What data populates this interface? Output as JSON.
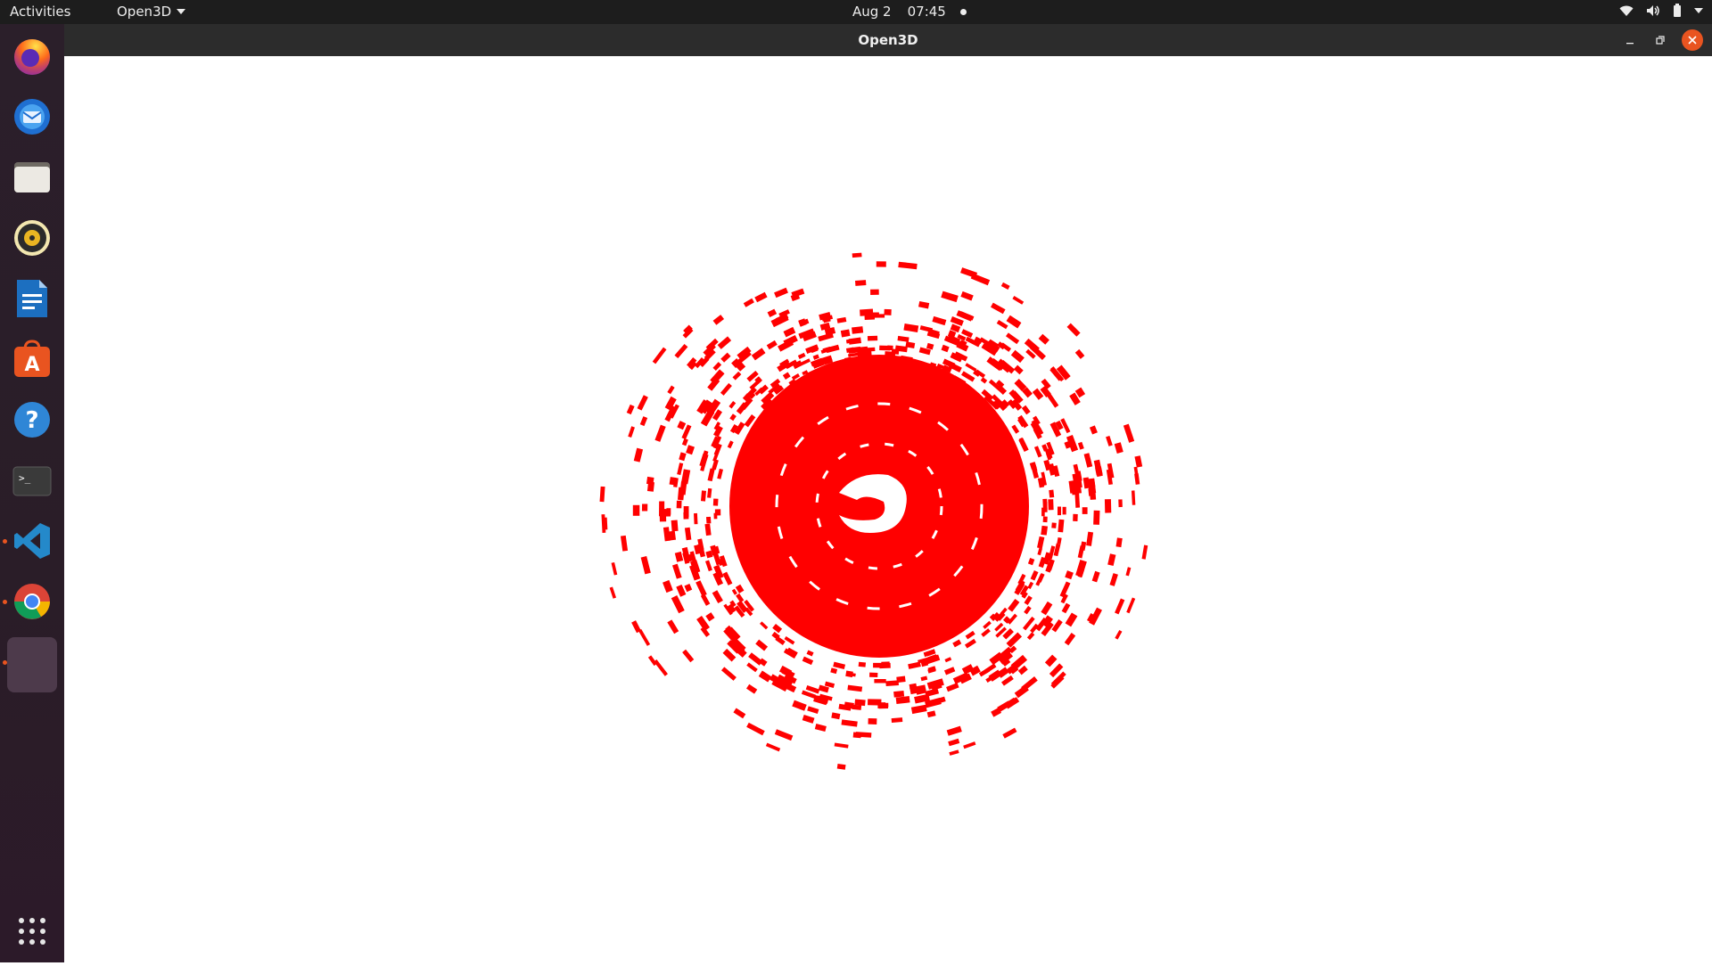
{
  "topbar": {
    "activities_label": "Activities",
    "app_menu_label": "Open3D",
    "date": "Aug 2",
    "time": "07:45"
  },
  "dock": {
    "items": [
      {
        "name": "firefox",
        "icon": "firefox-icon"
      },
      {
        "name": "thunderbird",
        "icon": "thunderbird-icon"
      },
      {
        "name": "files",
        "icon": "files-icon"
      },
      {
        "name": "rhythmbox",
        "icon": "rhythmbox-icon"
      },
      {
        "name": "libreoffice-writer",
        "icon": "writer-icon"
      },
      {
        "name": "software",
        "icon": "software-icon"
      },
      {
        "name": "help",
        "icon": "help-icon"
      },
      {
        "name": "terminal",
        "icon": "terminal-icon"
      },
      {
        "name": "vscode",
        "icon": "vscode-icon"
      },
      {
        "name": "chrome",
        "icon": "chrome-icon"
      },
      {
        "name": "open3d",
        "icon": "open3d-window-icon"
      }
    ],
    "show_apps_icon": "grid-icon"
  },
  "window": {
    "title": "Open3D",
    "point_color": "#ff0000",
    "background": "#ffffff"
  },
  "colors": {
    "accent": "#e95420",
    "topbar": "#1d1d1d",
    "titlebar": "#2c2c2c"
  }
}
